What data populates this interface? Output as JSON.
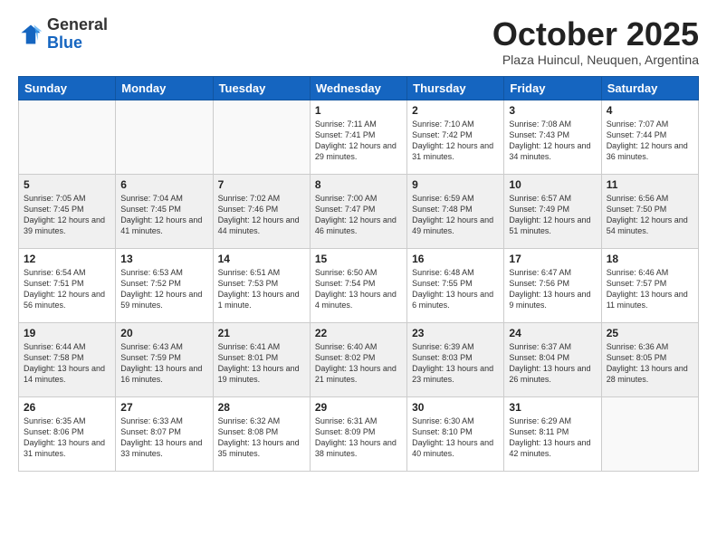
{
  "header": {
    "logo_general": "General",
    "logo_blue": "Blue",
    "month_title": "October 2025",
    "subtitle": "Plaza Huincul, Neuquen, Argentina"
  },
  "weekdays": [
    "Sunday",
    "Monday",
    "Tuesday",
    "Wednesday",
    "Thursday",
    "Friday",
    "Saturday"
  ],
  "weeks": [
    [
      {
        "day": "",
        "info": ""
      },
      {
        "day": "",
        "info": ""
      },
      {
        "day": "",
        "info": ""
      },
      {
        "day": "1",
        "info": "Sunrise: 7:11 AM\nSunset: 7:41 PM\nDaylight: 12 hours\nand 29 minutes."
      },
      {
        "day": "2",
        "info": "Sunrise: 7:10 AM\nSunset: 7:42 PM\nDaylight: 12 hours\nand 31 minutes."
      },
      {
        "day": "3",
        "info": "Sunrise: 7:08 AM\nSunset: 7:43 PM\nDaylight: 12 hours\nand 34 minutes."
      },
      {
        "day": "4",
        "info": "Sunrise: 7:07 AM\nSunset: 7:44 PM\nDaylight: 12 hours\nand 36 minutes."
      }
    ],
    [
      {
        "day": "5",
        "info": "Sunrise: 7:05 AM\nSunset: 7:45 PM\nDaylight: 12 hours\nand 39 minutes."
      },
      {
        "day": "6",
        "info": "Sunrise: 7:04 AM\nSunset: 7:45 PM\nDaylight: 12 hours\nand 41 minutes."
      },
      {
        "day": "7",
        "info": "Sunrise: 7:02 AM\nSunset: 7:46 PM\nDaylight: 12 hours\nand 44 minutes."
      },
      {
        "day": "8",
        "info": "Sunrise: 7:00 AM\nSunset: 7:47 PM\nDaylight: 12 hours\nand 46 minutes."
      },
      {
        "day": "9",
        "info": "Sunrise: 6:59 AM\nSunset: 7:48 PM\nDaylight: 12 hours\nand 49 minutes."
      },
      {
        "day": "10",
        "info": "Sunrise: 6:57 AM\nSunset: 7:49 PM\nDaylight: 12 hours\nand 51 minutes."
      },
      {
        "day": "11",
        "info": "Sunrise: 6:56 AM\nSunset: 7:50 PM\nDaylight: 12 hours\nand 54 minutes."
      }
    ],
    [
      {
        "day": "12",
        "info": "Sunrise: 6:54 AM\nSunset: 7:51 PM\nDaylight: 12 hours\nand 56 minutes."
      },
      {
        "day": "13",
        "info": "Sunrise: 6:53 AM\nSunset: 7:52 PM\nDaylight: 12 hours\nand 59 minutes."
      },
      {
        "day": "14",
        "info": "Sunrise: 6:51 AM\nSunset: 7:53 PM\nDaylight: 13 hours\nand 1 minute."
      },
      {
        "day": "15",
        "info": "Sunrise: 6:50 AM\nSunset: 7:54 PM\nDaylight: 13 hours\nand 4 minutes."
      },
      {
        "day": "16",
        "info": "Sunrise: 6:48 AM\nSunset: 7:55 PM\nDaylight: 13 hours\nand 6 minutes."
      },
      {
        "day": "17",
        "info": "Sunrise: 6:47 AM\nSunset: 7:56 PM\nDaylight: 13 hours\nand 9 minutes."
      },
      {
        "day": "18",
        "info": "Sunrise: 6:46 AM\nSunset: 7:57 PM\nDaylight: 13 hours\nand 11 minutes."
      }
    ],
    [
      {
        "day": "19",
        "info": "Sunrise: 6:44 AM\nSunset: 7:58 PM\nDaylight: 13 hours\nand 14 minutes."
      },
      {
        "day": "20",
        "info": "Sunrise: 6:43 AM\nSunset: 7:59 PM\nDaylight: 13 hours\nand 16 minutes."
      },
      {
        "day": "21",
        "info": "Sunrise: 6:41 AM\nSunset: 8:01 PM\nDaylight: 13 hours\nand 19 minutes."
      },
      {
        "day": "22",
        "info": "Sunrise: 6:40 AM\nSunset: 8:02 PM\nDaylight: 13 hours\nand 21 minutes."
      },
      {
        "day": "23",
        "info": "Sunrise: 6:39 AM\nSunset: 8:03 PM\nDaylight: 13 hours\nand 23 minutes."
      },
      {
        "day": "24",
        "info": "Sunrise: 6:37 AM\nSunset: 8:04 PM\nDaylight: 13 hours\nand 26 minutes."
      },
      {
        "day": "25",
        "info": "Sunrise: 6:36 AM\nSunset: 8:05 PM\nDaylight: 13 hours\nand 28 minutes."
      }
    ],
    [
      {
        "day": "26",
        "info": "Sunrise: 6:35 AM\nSunset: 8:06 PM\nDaylight: 13 hours\nand 31 minutes."
      },
      {
        "day": "27",
        "info": "Sunrise: 6:33 AM\nSunset: 8:07 PM\nDaylight: 13 hours\nand 33 minutes."
      },
      {
        "day": "28",
        "info": "Sunrise: 6:32 AM\nSunset: 8:08 PM\nDaylight: 13 hours\nand 35 minutes."
      },
      {
        "day": "29",
        "info": "Sunrise: 6:31 AM\nSunset: 8:09 PM\nDaylight: 13 hours\nand 38 minutes."
      },
      {
        "day": "30",
        "info": "Sunrise: 6:30 AM\nSunset: 8:10 PM\nDaylight: 13 hours\nand 40 minutes."
      },
      {
        "day": "31",
        "info": "Sunrise: 6:29 AM\nSunset: 8:11 PM\nDaylight: 13 hours\nand 42 minutes."
      },
      {
        "day": "",
        "info": ""
      }
    ]
  ]
}
